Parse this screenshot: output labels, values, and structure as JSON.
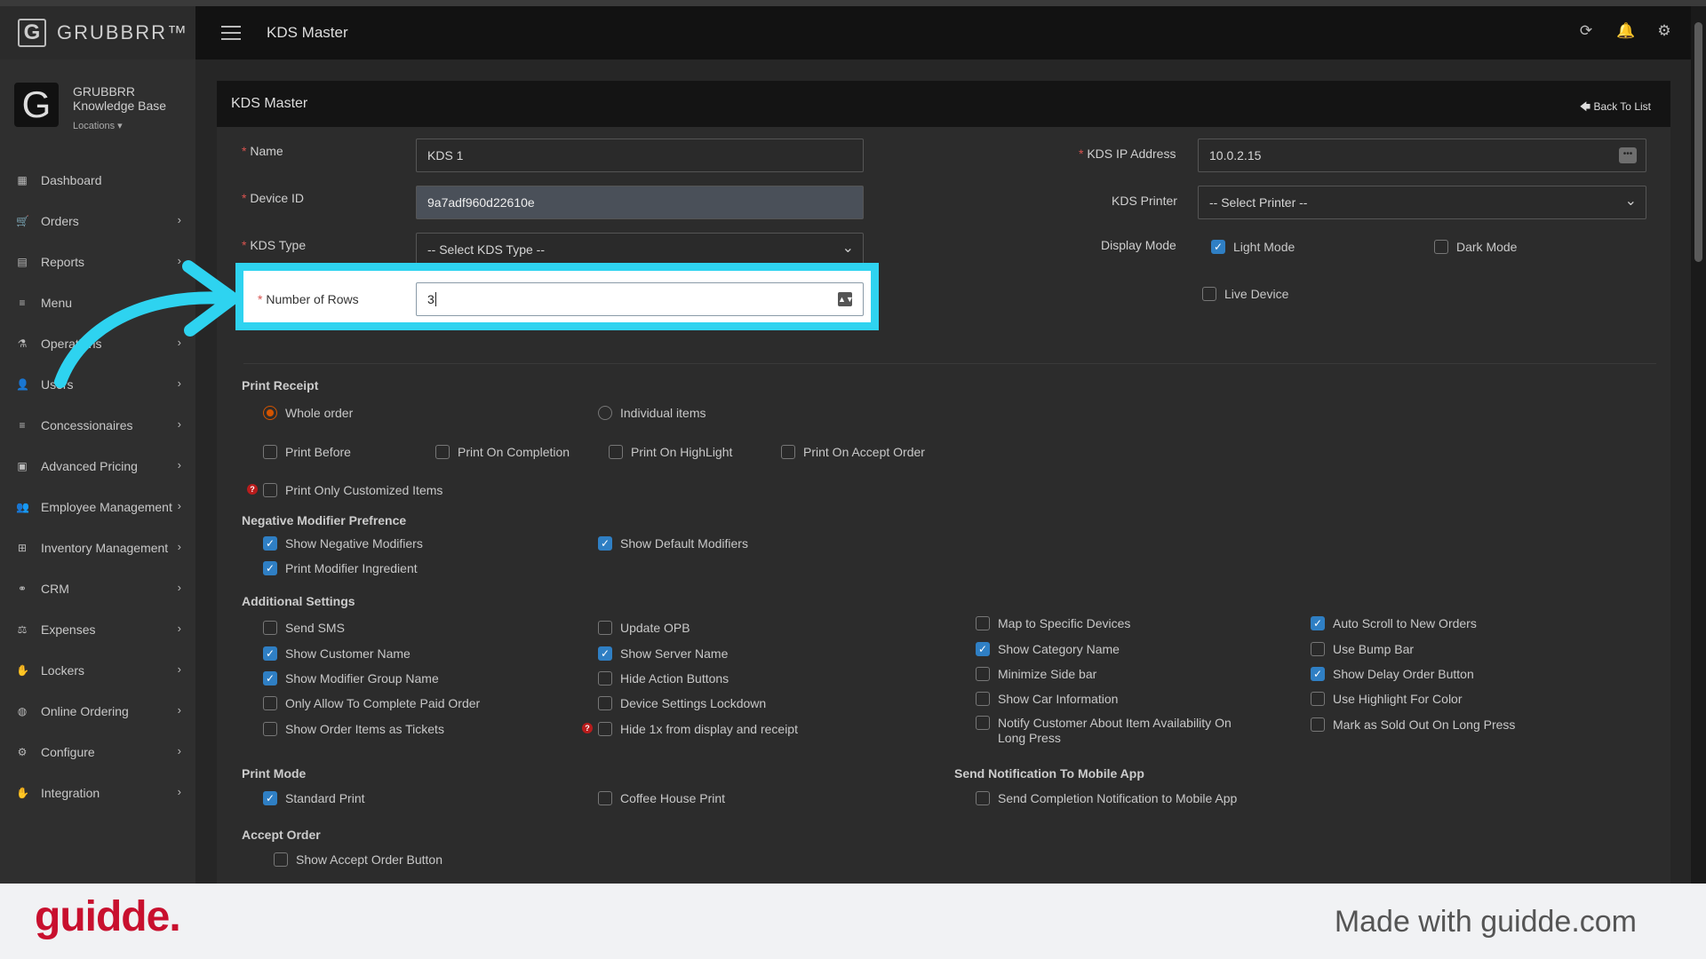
{
  "app": {
    "brand_name": "GRUBBRR™",
    "brand_letter": "G",
    "page_title": "KDS Master"
  },
  "sidebar": {
    "org_name": "GRUBBRR Knowledge Base",
    "locations_label": "Locations ▾",
    "items": [
      {
        "label": "Dashboard",
        "icon": "dashboard-icon",
        "glyph": "▦",
        "has_children": false
      },
      {
        "label": "Orders",
        "icon": "cart-icon",
        "glyph": "🛒",
        "has_children": true
      },
      {
        "label": "Reports",
        "icon": "report-icon",
        "glyph": "▤",
        "has_children": true
      },
      {
        "label": "Menu",
        "icon": "menu-list-icon",
        "glyph": "≡",
        "has_children": false
      },
      {
        "label": "Operations",
        "icon": "flask-icon",
        "glyph": "⚗",
        "has_children": true
      },
      {
        "label": "Users",
        "icon": "user-icon",
        "glyph": "👤",
        "has_children": true
      },
      {
        "label": "Concessionaires",
        "icon": "list-icon",
        "glyph": "≡",
        "has_children": true
      },
      {
        "label": "Advanced Pricing",
        "icon": "money-icon",
        "glyph": "▣",
        "has_children": true
      },
      {
        "label": "Employee Management",
        "icon": "users-icon",
        "glyph": "👥",
        "has_children": true
      },
      {
        "label": "Inventory Management",
        "icon": "sitemap-icon",
        "glyph": "⊞",
        "has_children": true
      },
      {
        "label": "CRM",
        "icon": "link-icon",
        "glyph": "⚭",
        "has_children": true
      },
      {
        "label": "Expenses",
        "icon": "scale-icon",
        "glyph": "⚖",
        "has_children": true
      },
      {
        "label": "Lockers",
        "icon": "locker-icon",
        "glyph": "✋",
        "has_children": true
      },
      {
        "label": "Online Ordering",
        "icon": "globe-icon",
        "glyph": "◍",
        "has_children": true
      },
      {
        "label": "Configure",
        "icon": "gear-icon",
        "glyph": "⚙",
        "has_children": true
      },
      {
        "label": "Integration",
        "icon": "plug-icon",
        "glyph": "✋",
        "has_children": true
      }
    ]
  },
  "panel": {
    "title": "KDS Master",
    "back_label": "Back To List"
  },
  "form": {
    "name_label": "Name",
    "name_value": "KDS 1",
    "device_id_label": "Device ID",
    "device_id_value": "9a7adf960d22610e",
    "kds_type_label": "KDS Type",
    "kds_type_value": "-- Select KDS Type --",
    "rows_label": "Number of Rows",
    "rows_value": "3",
    "ip_label": "KDS IP Address",
    "ip_value": "10.0.2.15",
    "printer_label": "KDS Printer",
    "printer_value": "-- Select Printer --",
    "display_mode_label": "Display Mode",
    "light_mode": "Light Mode",
    "dark_mode": "Dark Mode",
    "live_device": "Live Device"
  },
  "print_receipt": {
    "heading": "Print Receipt",
    "whole_order": "Whole order",
    "individual_items": "Individual items",
    "print_before": "Print Before",
    "print_on_completion": "Print On Completion",
    "print_on_highlight": "Print On HighLight",
    "print_on_accept": "Print On Accept Order",
    "print_only_customized": "Print Only Customized Items"
  },
  "negative_modifier": {
    "heading": "Negative Modifier Prefrence",
    "show_negative": "Show Negative Modifiers",
    "show_default": "Show Default Modifiers",
    "print_ingredient": "Print Modifier Ingredient"
  },
  "additional": {
    "heading": "Additional Settings",
    "send_sms": "Send SMS",
    "update_opb": "Update OPB",
    "map_devices": "Map to Specific Devices",
    "auto_scroll": "Auto Scroll to New Orders",
    "show_customer_name": "Show Customer Name",
    "show_server_name": "Show Server Name",
    "show_category_name": "Show Category Name",
    "use_bump_bar": "Use Bump Bar",
    "show_modifier_group": "Show Modifier Group Name",
    "hide_action_buttons": "Hide Action Buttons",
    "minimize_side_bar": "Minimize Side bar",
    "show_delay_order": "Show Delay Order Button",
    "only_allow_paid": "Only Allow To Complete Paid Order",
    "device_lockdown": "Device Settings Lockdown",
    "show_car_info": "Show Car Information",
    "use_highlight_color": "Use Highlight For Color",
    "show_items_tickets": "Show Order Items as Tickets",
    "hide_1x": "Hide 1x from display and receipt",
    "notify_customer": "Notify Customer About Item Availability On Long Press",
    "mark_sold_out": "Mark as Sold Out On Long Press"
  },
  "print_mode": {
    "heading": "Print Mode",
    "standard": "Standard Print",
    "coffee_house": "Coffee House Print"
  },
  "notification": {
    "heading": "Send Notification To Mobile App",
    "send_completion": "Send Completion Notification to Mobile App"
  },
  "accept_order": {
    "heading": "Accept Order",
    "show_button": "Show Accept Order Button"
  },
  "footer": {
    "logo": "guidde.",
    "text": "Made with guidde.com"
  },
  "colors": {
    "highlight": "#2ed3f0",
    "checkbox_on": "#2f7fc4",
    "brand_red": "#c8102e"
  }
}
